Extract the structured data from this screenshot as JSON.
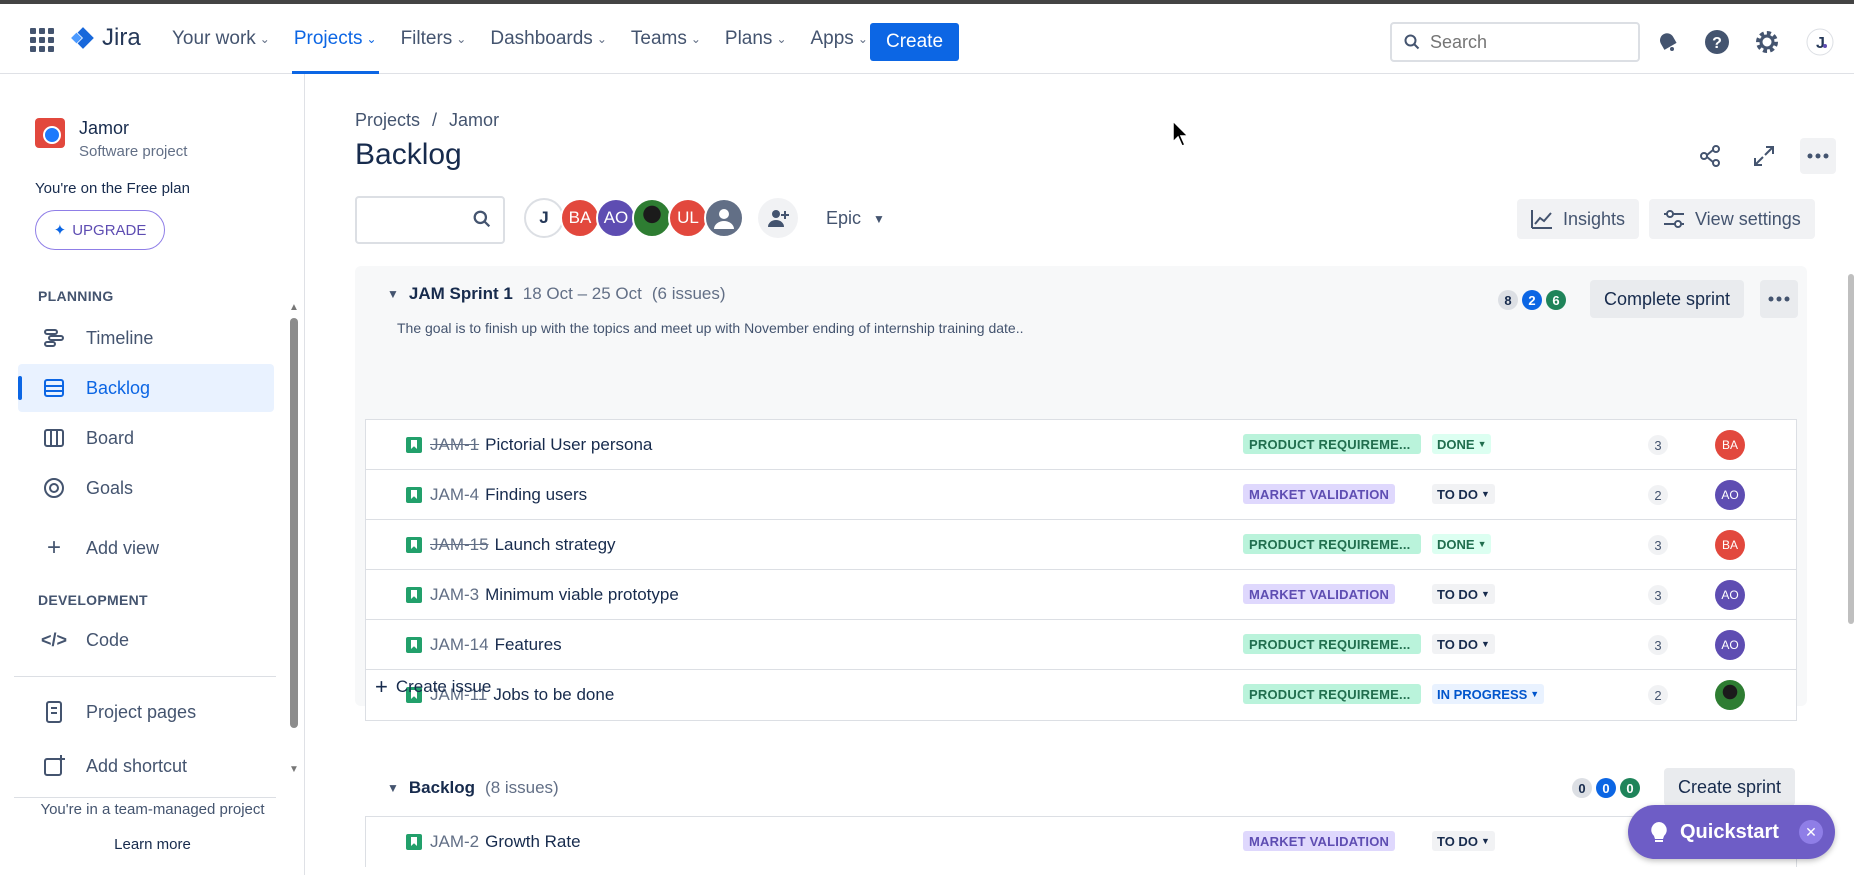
{
  "topnav": {
    "logo": "Jira",
    "items": [
      {
        "label": "Your work"
      },
      {
        "label": "Projects"
      },
      {
        "label": "Filters"
      },
      {
        "label": "Dashboards"
      },
      {
        "label": "Teams"
      },
      {
        "label": "Plans"
      },
      {
        "label": "Apps"
      }
    ],
    "active": "Projects",
    "create_label": "Create",
    "search_placeholder": "Search",
    "icons": [
      "notifications-icon",
      "help-icon",
      "settings-icon",
      "profile-avatar"
    ]
  },
  "sidebar": {
    "project_name": "Jamor",
    "project_type": "Software project",
    "plan_text": "You're on the Free plan",
    "upgrade_label": "UPGRADE",
    "planning_header": "PLANNING",
    "planning_items": [
      {
        "label": "Timeline",
        "icon": "timeline-icon"
      },
      {
        "label": "Backlog",
        "icon": "backlog-icon",
        "active": true
      },
      {
        "label": "Board",
        "icon": "board-icon"
      },
      {
        "label": "Goals",
        "icon": "goals-icon"
      }
    ],
    "add_view_label": "Add view",
    "development_header": "DEVELOPMENT",
    "code_label": "Code",
    "project_pages_label": "Project pages",
    "add_shortcut_label": "Add shortcut",
    "footer_text": "You're in a team-managed project",
    "learn_more_label": "Learn more"
  },
  "main": {
    "breadcrumb": [
      "Projects",
      "Jamor"
    ],
    "breadcrumb_sep": "/",
    "title": "Backlog",
    "avatars": [
      {
        "initials": "J",
        "color": "#ffffff"
      },
      {
        "initials": "BA",
        "color": "#e2483d"
      },
      {
        "initials": "AO",
        "color": "#5e4db2"
      },
      {
        "initials": "",
        "color": "#2e7d32"
      },
      {
        "initials": "UL",
        "color": "#e2483d"
      },
      {
        "initials": "",
        "color": "#626f86"
      }
    ],
    "epic_label": "Epic",
    "insights_label": "Insights",
    "view_settings_label": "View settings"
  },
  "sprint": {
    "name": "JAM Sprint 1",
    "dates": "18 Oct – 25 Oct",
    "issue_count": "(6 issues)",
    "goal": "The goal is to finish up with the topics and meet up with November ending of internship training date..",
    "counts": {
      "todo": "8",
      "in_progress": "2",
      "done": "6"
    },
    "complete_label": "Complete sprint",
    "issues": [
      {
        "key": "JAM-1",
        "title": "Pictorial User persona",
        "done": true,
        "epic": "PRODUCT REQUIREME...",
        "epic_color": "green",
        "status": "DONE",
        "status_kind": "done",
        "points": "3",
        "assignee": "BA",
        "assignee_color": "#e2483d"
      },
      {
        "key": "JAM-4",
        "title": "Finding users",
        "done": false,
        "epic": "MARKET VALIDATION",
        "epic_color": "purple",
        "status": "TO DO",
        "status_kind": "todo",
        "points": "2",
        "assignee": "AO",
        "assignee_color": "#5e4db2"
      },
      {
        "key": "JAM-15",
        "title": "Launch strategy",
        "done": true,
        "epic": "PRODUCT REQUIREME...",
        "epic_color": "green",
        "status": "DONE",
        "status_kind": "done",
        "points": "3",
        "assignee": "BA",
        "assignee_color": "#e2483d"
      },
      {
        "key": "JAM-3",
        "title": "Minimum viable prototype",
        "done": false,
        "epic": "MARKET VALIDATION",
        "epic_color": "purple",
        "status": "TO DO",
        "status_kind": "todo",
        "points": "3",
        "assignee": "AO",
        "assignee_color": "#5e4db2"
      },
      {
        "key": "JAM-14",
        "title": "Features",
        "done": false,
        "epic": "PRODUCT REQUIREME...",
        "epic_color": "green",
        "status": "TO DO",
        "status_kind": "todo",
        "points": "3",
        "assignee": "AO",
        "assignee_color": "#5e4db2"
      },
      {
        "key": "JAM-11",
        "title": "Jobs to be done",
        "done": false,
        "epic": "PRODUCT REQUIREME...",
        "epic_color": "green",
        "status": "IN PROGRESS",
        "status_kind": "prog",
        "points": "2",
        "assignee": "",
        "assignee_color": "#2e7d32"
      }
    ],
    "create_issue_label": "Create issue"
  },
  "backlog": {
    "name": "Backlog",
    "issue_count": "(8 issues)",
    "counts": {
      "todo": "0",
      "in_progress": "0",
      "done": "0"
    },
    "create_sprint_label": "Create sprint",
    "issues": [
      {
        "key": "JAM-2",
        "title": "Growth Rate",
        "done": false,
        "epic": "MARKET VALIDATION",
        "epic_color": "purple",
        "status": "TO DO",
        "status_kind": "todo"
      }
    ]
  },
  "quickstart": {
    "label": "Quickstart"
  }
}
